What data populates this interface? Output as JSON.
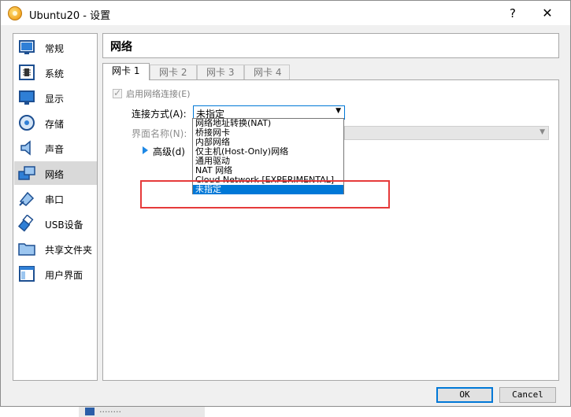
{
  "window": {
    "title": "Ubuntu20 - 设置",
    "help": "?",
    "close": "✕"
  },
  "sidebar": {
    "items": [
      {
        "label": "常规",
        "icon": "general-icon"
      },
      {
        "label": "系统",
        "icon": "system-icon"
      },
      {
        "label": "显示",
        "icon": "display-icon"
      },
      {
        "label": "存储",
        "icon": "storage-icon"
      },
      {
        "label": "声音",
        "icon": "audio-icon"
      },
      {
        "label": "网络",
        "icon": "network-icon",
        "selected": true
      },
      {
        "label": "串口",
        "icon": "serial-port-icon"
      },
      {
        "label": "USB设备",
        "icon": "usb-icon"
      },
      {
        "label": "共享文件夹",
        "icon": "shared-folder-icon"
      },
      {
        "label": "用户界面",
        "icon": "user-interface-icon"
      }
    ]
  },
  "header": {
    "title": "网络"
  },
  "tabs": [
    {
      "label": "网卡 1",
      "active": true
    },
    {
      "label": "网卡 2"
    },
    {
      "label": "网卡 3"
    },
    {
      "label": "网卡 4"
    }
  ],
  "form": {
    "enable_label": "启用网络连接(E)",
    "attached_label": "连接方式(A):",
    "attached_value": "未指定",
    "name_label": "界面名称(N):",
    "advanced_label": "高级(d)"
  },
  "dropdown": {
    "options": [
      "网络地址转换(NAT)",
      "桥接网卡",
      "内部网络",
      "仅主机(Host-Only)网络",
      "通用驱动",
      "NAT 网络",
      "Cloud Network [EXPERIMENTAL]",
      "未指定"
    ],
    "highlighted": "未指定"
  },
  "buttons": {
    "ok": "OK",
    "cancel": "Cancel"
  },
  "background": {
    "bottom_text": "........"
  },
  "colors": {
    "accent": "#0078d7",
    "annotation": "#e63a3a"
  }
}
